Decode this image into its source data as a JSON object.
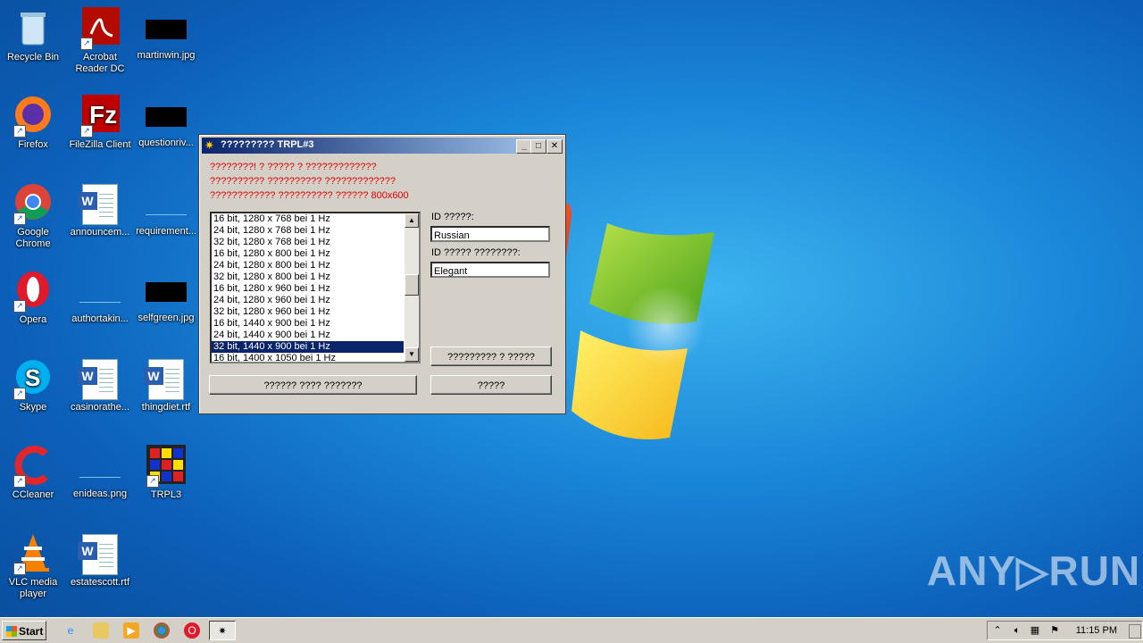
{
  "desktop": {
    "icons": [
      {
        "label": "Recycle Bin"
      },
      {
        "label": "Acrobat Reader DC"
      },
      {
        "label": "martinwin.jpg"
      },
      {
        "label": "Firefox"
      },
      {
        "label": "FileZilla Client"
      },
      {
        "label": "questionriv..."
      },
      {
        "label": "Google Chrome"
      },
      {
        "label": "announcem..."
      },
      {
        "label": "requirement..."
      },
      {
        "label": "Opera"
      },
      {
        "label": "authortakin..."
      },
      {
        "label": "selfgreen.jpg"
      },
      {
        "label": "Skype"
      },
      {
        "label": "casinorathe..."
      },
      {
        "label": "thingdiet.rtf"
      },
      {
        "label": "CCleaner"
      },
      {
        "label": "enideas.png"
      },
      {
        "label": "TRPL3"
      },
      {
        "label": "VLC media player"
      },
      {
        "label": "estatescott.rtf"
      }
    ]
  },
  "dialog": {
    "title": "????????? TRPL#3",
    "message_lines": [
      "????????! ? ????? ? ?????????????",
      "?????????? ?????????? ?????????????",
      "???????????? ?????????? ?????? 800x600"
    ],
    "resolutions": [
      "16 bit, 1280 x 768 bei 1 Hz",
      "24 bit, 1280 x 768 bei 1 Hz",
      "32 bit, 1280 x 768 bei 1 Hz",
      "16 bit, 1280 x 800 bei 1 Hz",
      "24 bit, 1280 x 800 bei 1 Hz",
      "32 bit, 1280 x 800 bei 1 Hz",
      "16 bit, 1280 x 960 bei 1 Hz",
      "24 bit, 1280 x 960 bei 1 Hz",
      "32 bit, 1280 x 960 bei 1 Hz",
      "16 bit, 1440 x 900 bei 1 Hz",
      "24 bit, 1440 x 900 bei 1 Hz",
      "32 bit, 1440 x 900 bei 1 Hz",
      "16 bit, 1400 x 1050 bei 1 Hz"
    ],
    "selected_index": 11,
    "id_label": "ID ?????:",
    "id_value": "Russian",
    "id2_label": "ID ????? ????????:",
    "id2_value": "Elegant",
    "button_save": "????????? ? ?????",
    "button_bottom_left": "?????? ???? ???????",
    "button_exit": "?????"
  },
  "taskbar": {
    "start_label": "Start",
    "clock": "11:15 PM"
  },
  "watermark": "ANY▷RUN"
}
